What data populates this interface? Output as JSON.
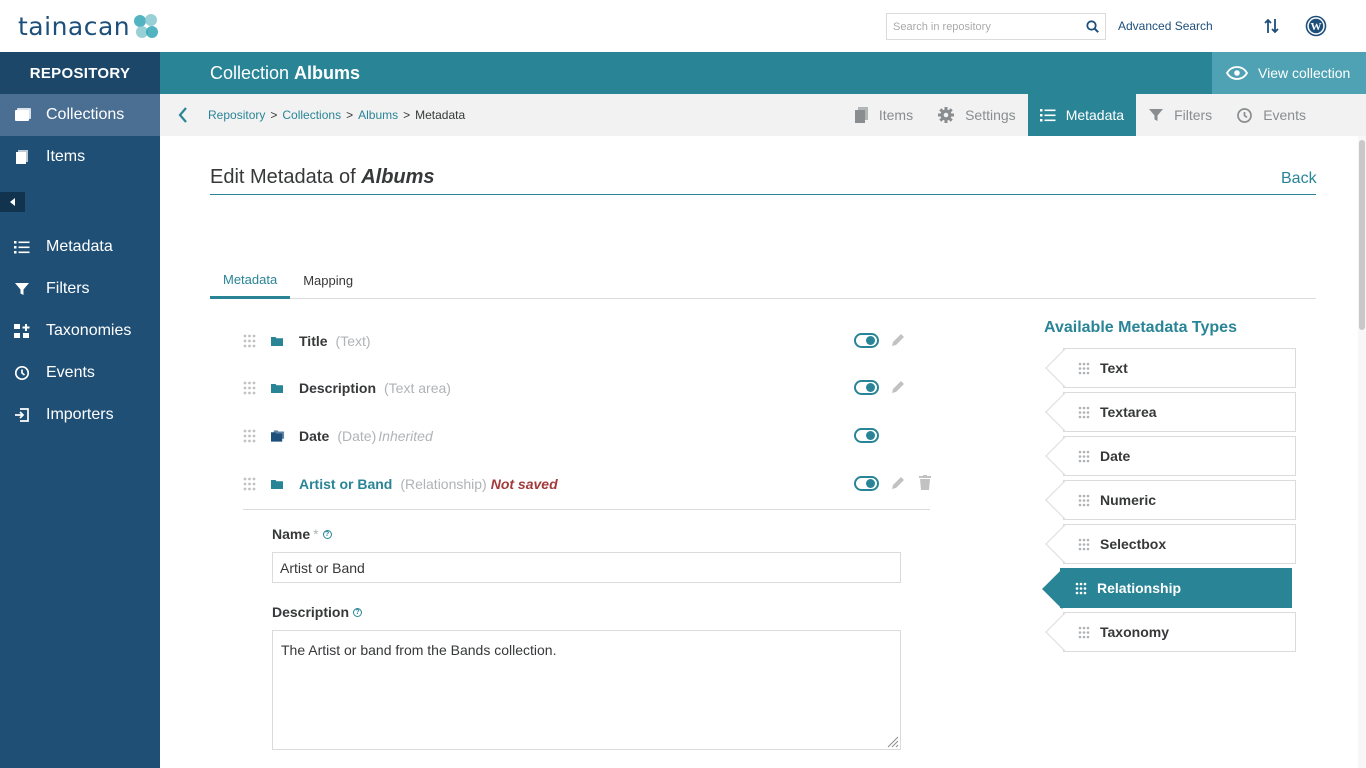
{
  "app": {
    "logo_text": "tainacan"
  },
  "topbar": {
    "search_placeholder": "Search in repository",
    "advanced_search": "Advanced Search"
  },
  "sidebar": {
    "header": "REPOSITORY",
    "items": [
      {
        "label": "Collections",
        "icon": "collections-icon",
        "active": true
      },
      {
        "label": "Items",
        "icon": "items-icon"
      },
      {
        "label": "Metadata",
        "icon": "metadata-list-icon"
      },
      {
        "label": "Filters",
        "icon": "filter-icon"
      },
      {
        "label": "Taxonomies",
        "icon": "taxonomies-icon"
      },
      {
        "label": "Events",
        "icon": "events-icon"
      },
      {
        "label": "Importers",
        "icon": "importers-icon"
      }
    ]
  },
  "collection_header": {
    "prefix": "Collection",
    "name": "Albums",
    "view_button": "View collection"
  },
  "breadcrumb": {
    "items": [
      "Repository",
      "Collections",
      "Albums"
    ],
    "current": "Metadata"
  },
  "collection_tabs": [
    {
      "label": "Items"
    },
    {
      "label": "Settings"
    },
    {
      "label": "Metadata",
      "active": true
    },
    {
      "label": "Filters"
    },
    {
      "label": "Events"
    }
  ],
  "page": {
    "title_prefix": "Edit Metadata of",
    "title_name": "Albums",
    "back": "Back"
  },
  "inner_tabs": [
    {
      "label": "Metadata",
      "active": true
    },
    {
      "label": "Mapping"
    }
  ],
  "metadata_list": [
    {
      "name": "Title",
      "type": "(Text)",
      "extra": "",
      "enabled": true
    },
    {
      "name": "Description",
      "type": "(Text area)",
      "extra": "",
      "enabled": true
    },
    {
      "name": "Date",
      "type": "(Date)",
      "extra": "Inherited",
      "enabled": true
    },
    {
      "name": "Artist or Band",
      "type": "(Relationship)",
      "extra": "Not saved",
      "enabled": true
    }
  ],
  "edit_form": {
    "name_label": "Name",
    "name_required": "*",
    "name_value": "Artist or Band",
    "description_label": "Description",
    "description_value": "The Artist or band from the Bands collection."
  },
  "available_types": {
    "title": "Available Metadata Types",
    "items": [
      "Text",
      "Textarea",
      "Date",
      "Numeric",
      "Selectbox",
      "Relationship",
      "Taxonomy"
    ],
    "active": "Relationship"
  },
  "colors": {
    "primary": "#298596",
    "sidebar": "#1f4f75",
    "error": "#a33a3a"
  }
}
